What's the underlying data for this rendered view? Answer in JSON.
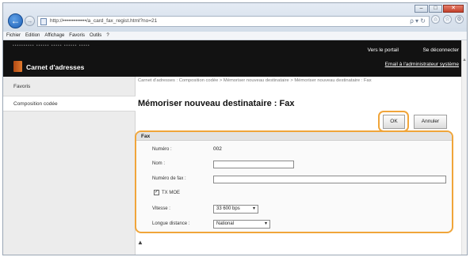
{
  "browser": {
    "url": "http://•••••••••••••/a_card_fax_regist.html?no=21",
    "window_controls": [
      "–",
      "□",
      "✕"
    ],
    "tab_icons": [
      "⌂",
      "☆",
      "⚙"
    ],
    "addr_tools": "ρ ▾ ↻",
    "menu": [
      "Fichier",
      "Edition",
      "Affichage",
      "Favoris",
      "Outils",
      "?"
    ]
  },
  "header": {
    "device_info": "••••••••••   ••••••  •••••   •••••• •••••",
    "title": "Carnet d'adresses",
    "portal_link": "Vers le portail",
    "logout_link": "Se déconnecter",
    "mail_link": "Email à l'administrateur système"
  },
  "sidebar": {
    "items": [
      {
        "label": "Favoris"
      },
      {
        "label": "Composition codée"
      }
    ]
  },
  "main": {
    "breadcrumb": "Carnet d'adresses : Composition codée > Mémoriser nouveau destinataire > Mémoriser nouveau destinataire : Fax",
    "title": "Mémoriser nouveau destinataire : Fax",
    "ok_label": "OK",
    "cancel_label": "Annuler",
    "scroll_top": "▲"
  },
  "fax_form": {
    "section": "Fax",
    "number_label": "Numéro :",
    "number_value": "002",
    "name_label": "Nom :",
    "name_value": "",
    "fax_number_label": "Numéro de fax :",
    "fax_number_value": "",
    "tx_mode_label": "TX MOE",
    "tx_mode_checked": true,
    "tx_mode_mark": "✓",
    "speed_label": "Vitesse :",
    "speed_value": "33 600 bps",
    "long_distance_label": "Longue distance :",
    "long_distance_value": "National",
    "select_arrow": "▾"
  },
  "colors": {
    "highlight": "#f0a53a",
    "header_bg": "#121212"
  }
}
